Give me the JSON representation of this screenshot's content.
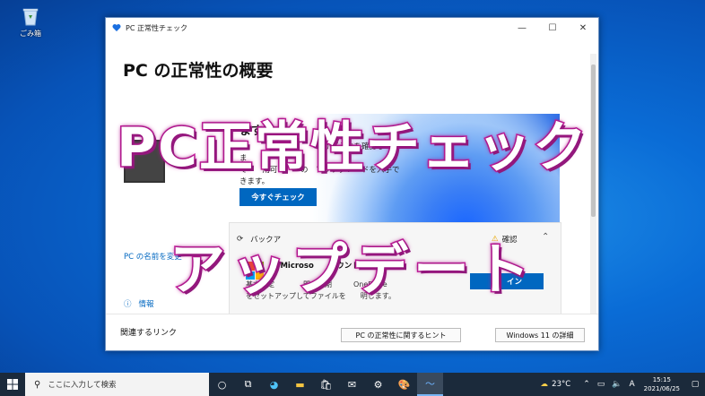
{
  "desktop": {
    "recycle_bin_label": "ごみ箱"
  },
  "window": {
    "title": "PC 正常性チェック",
    "controls": {
      "minimize": "—",
      "maximize": "☐",
      "close": "✕"
    },
    "page_title": "PC の正常性の概要",
    "check_card": {
      "title": "ます",
      "text": "こ　　　ム　　　　　るかどうかを確認してみ\nま\nで　　用可　　　の　アップグレードを入手で\nきます。",
      "button": "今すぐチェック"
    },
    "backup_card": {
      "title": "バックア",
      "warning": "確認",
      "line1": "に Microso　　カウント　イン",
      "line2": "基本設定　　　　間で同期　　　OneDrive\nをセットアップしてファイルを　　明します。",
      "button": "サ　イン"
    },
    "left_nav": {
      "rename_link": "PC の名前を変更",
      "info": "情報"
    },
    "footer": {
      "related": "関連するリンク",
      "tips_button": "PC の正常性に関するヒント",
      "win11_button": "Windows 11 の詳細"
    }
  },
  "overlay": {
    "line1": "PC正常性チェック",
    "line2": "アップデート"
  },
  "taskbar": {
    "search_placeholder": "ここに入力して検索",
    "weather": "23°C",
    "ime": "A",
    "time": "15:15",
    "date": "2021/06/25"
  }
}
